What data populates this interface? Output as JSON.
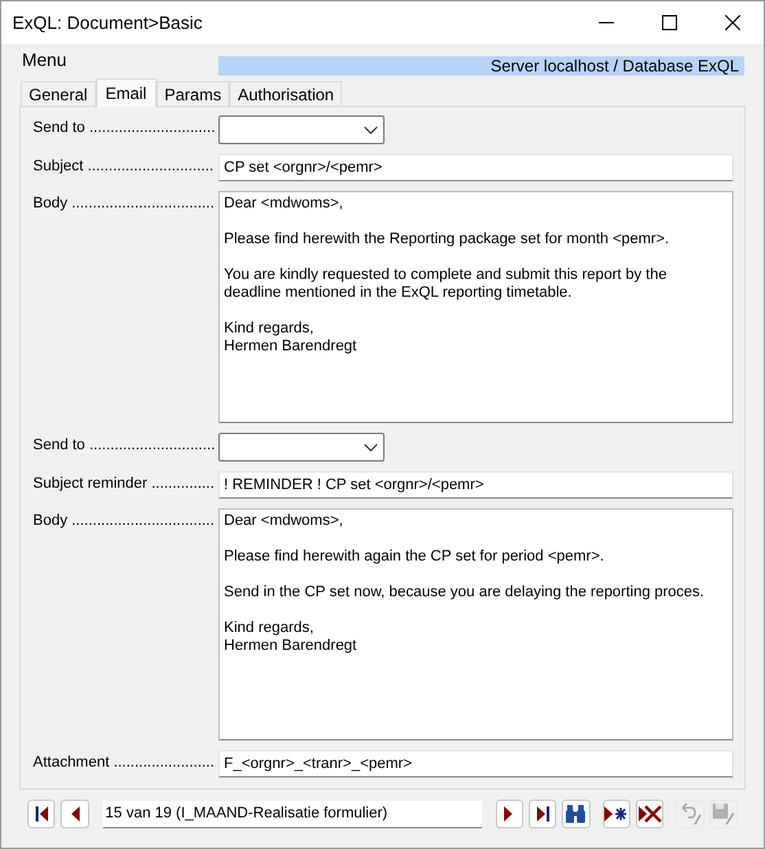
{
  "window": {
    "title": "ExQL: Document>Basic"
  },
  "menu": {
    "label": "Menu"
  },
  "status": "Server localhost / Database ExQL",
  "tabs": [
    {
      "label": "General",
      "selected": false
    },
    {
      "label": "Email",
      "selected": true
    },
    {
      "label": "Params",
      "selected": false
    },
    {
      "label": "Authorisation",
      "selected": false
    }
  ],
  "fields": [
    {
      "kind": "dropdown",
      "label": "Send to .............................."
    },
    {
      "kind": "text",
      "label": "Subject ..............................",
      "value": "CP set <orgnr>/<pemr>"
    },
    {
      "kind": "memo",
      "label": "Body ..................................",
      "paragraphs": [
        "Dear <mdwoms>,",
        "Please find herewith the Reporting package set for month <pemr>.",
        "You are kindly requested to complete and submit this report by the deadline mentioned in the ExQL reporting timetable.",
        "Kind regards,\nHermen Barendregt"
      ]
    },
    {
      "kind": "dropdown",
      "label": "Send to .............................."
    },
    {
      "kind": "text",
      "label": "Subject reminder ...............",
      "value": "! REMINDER ! CP set <orgnr>/<pemr>"
    },
    {
      "kind": "memo",
      "label": "Body ..................................",
      "paragraphs": [
        "Dear <mdwoms>,",
        "Please find herewith again the CP set for period <pemr>.",
        "Send in the CP set now, because you are delaying the reporting proces.",
        "Kind regards,\nHermen Barendregt"
      ]
    },
    {
      "kind": "text",
      "label": "Attachment ........................",
      "value": "F_<orgnr>_<tranr>_<pemr>"
    }
  ],
  "navigator": {
    "record": "15 van 19 (I_MAAND-Realisatie formulier)",
    "left_buttons": [
      {
        "kind": "first",
        "disabled": false
      },
      {
        "kind": "prev",
        "disabled": false
      }
    ],
    "right_buttons": [
      {
        "kind": "next",
        "disabled": false
      },
      {
        "kind": "last",
        "disabled": false
      },
      {
        "kind": "find",
        "disabled": false
      },
      {
        "kind": "new",
        "disabled": false
      },
      {
        "kind": "delete",
        "disabled": false
      },
      {
        "kind": "undo",
        "disabled": true
      },
      {
        "kind": "save",
        "disabled": true
      }
    ]
  }
}
